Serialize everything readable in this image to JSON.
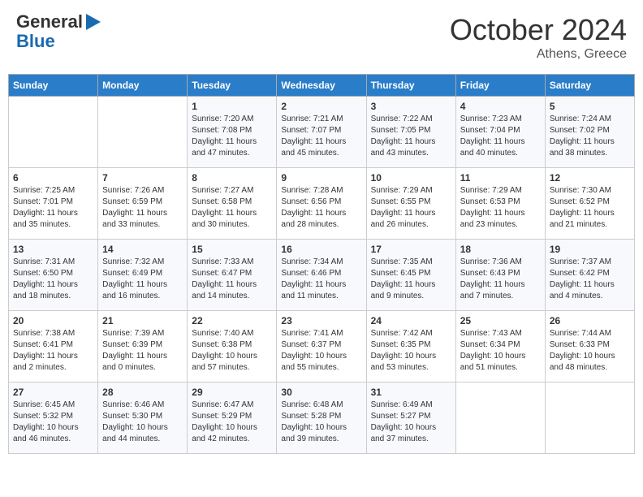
{
  "logo": {
    "general": "General",
    "blue": "Blue"
  },
  "title": {
    "month": "October 2024",
    "location": "Athens, Greece"
  },
  "days_of_week": [
    "Sunday",
    "Monday",
    "Tuesday",
    "Wednesday",
    "Thursday",
    "Friday",
    "Saturday"
  ],
  "weeks": [
    [
      {
        "day": "",
        "info": ""
      },
      {
        "day": "",
        "info": ""
      },
      {
        "day": "1",
        "info": "Sunrise: 7:20 AM\nSunset: 7:08 PM\nDaylight: 11 hours and 47 minutes."
      },
      {
        "day": "2",
        "info": "Sunrise: 7:21 AM\nSunset: 7:07 PM\nDaylight: 11 hours and 45 minutes."
      },
      {
        "day": "3",
        "info": "Sunrise: 7:22 AM\nSunset: 7:05 PM\nDaylight: 11 hours and 43 minutes."
      },
      {
        "day": "4",
        "info": "Sunrise: 7:23 AM\nSunset: 7:04 PM\nDaylight: 11 hours and 40 minutes."
      },
      {
        "day": "5",
        "info": "Sunrise: 7:24 AM\nSunset: 7:02 PM\nDaylight: 11 hours and 38 minutes."
      }
    ],
    [
      {
        "day": "6",
        "info": "Sunrise: 7:25 AM\nSunset: 7:01 PM\nDaylight: 11 hours and 35 minutes."
      },
      {
        "day": "7",
        "info": "Sunrise: 7:26 AM\nSunset: 6:59 PM\nDaylight: 11 hours and 33 minutes."
      },
      {
        "day": "8",
        "info": "Sunrise: 7:27 AM\nSunset: 6:58 PM\nDaylight: 11 hours and 30 minutes."
      },
      {
        "day": "9",
        "info": "Sunrise: 7:28 AM\nSunset: 6:56 PM\nDaylight: 11 hours and 28 minutes."
      },
      {
        "day": "10",
        "info": "Sunrise: 7:29 AM\nSunset: 6:55 PM\nDaylight: 11 hours and 26 minutes."
      },
      {
        "day": "11",
        "info": "Sunrise: 7:29 AM\nSunset: 6:53 PM\nDaylight: 11 hours and 23 minutes."
      },
      {
        "day": "12",
        "info": "Sunrise: 7:30 AM\nSunset: 6:52 PM\nDaylight: 11 hours and 21 minutes."
      }
    ],
    [
      {
        "day": "13",
        "info": "Sunrise: 7:31 AM\nSunset: 6:50 PM\nDaylight: 11 hours and 18 minutes."
      },
      {
        "day": "14",
        "info": "Sunrise: 7:32 AM\nSunset: 6:49 PM\nDaylight: 11 hours and 16 minutes."
      },
      {
        "day": "15",
        "info": "Sunrise: 7:33 AM\nSunset: 6:47 PM\nDaylight: 11 hours and 14 minutes."
      },
      {
        "day": "16",
        "info": "Sunrise: 7:34 AM\nSunset: 6:46 PM\nDaylight: 11 hours and 11 minutes."
      },
      {
        "day": "17",
        "info": "Sunrise: 7:35 AM\nSunset: 6:45 PM\nDaylight: 11 hours and 9 minutes."
      },
      {
        "day": "18",
        "info": "Sunrise: 7:36 AM\nSunset: 6:43 PM\nDaylight: 11 hours and 7 minutes."
      },
      {
        "day": "19",
        "info": "Sunrise: 7:37 AM\nSunset: 6:42 PM\nDaylight: 11 hours and 4 minutes."
      }
    ],
    [
      {
        "day": "20",
        "info": "Sunrise: 7:38 AM\nSunset: 6:41 PM\nDaylight: 11 hours and 2 minutes."
      },
      {
        "day": "21",
        "info": "Sunrise: 7:39 AM\nSunset: 6:39 PM\nDaylight: 11 hours and 0 minutes."
      },
      {
        "day": "22",
        "info": "Sunrise: 7:40 AM\nSunset: 6:38 PM\nDaylight: 10 hours and 57 minutes."
      },
      {
        "day": "23",
        "info": "Sunrise: 7:41 AM\nSunset: 6:37 PM\nDaylight: 10 hours and 55 minutes."
      },
      {
        "day": "24",
        "info": "Sunrise: 7:42 AM\nSunset: 6:35 PM\nDaylight: 10 hours and 53 minutes."
      },
      {
        "day": "25",
        "info": "Sunrise: 7:43 AM\nSunset: 6:34 PM\nDaylight: 10 hours and 51 minutes."
      },
      {
        "day": "26",
        "info": "Sunrise: 7:44 AM\nSunset: 6:33 PM\nDaylight: 10 hours and 48 minutes."
      }
    ],
    [
      {
        "day": "27",
        "info": "Sunrise: 6:45 AM\nSunset: 5:32 PM\nDaylight: 10 hours and 46 minutes."
      },
      {
        "day": "28",
        "info": "Sunrise: 6:46 AM\nSunset: 5:30 PM\nDaylight: 10 hours and 44 minutes."
      },
      {
        "day": "29",
        "info": "Sunrise: 6:47 AM\nSunset: 5:29 PM\nDaylight: 10 hours and 42 minutes."
      },
      {
        "day": "30",
        "info": "Sunrise: 6:48 AM\nSunset: 5:28 PM\nDaylight: 10 hours and 39 minutes."
      },
      {
        "day": "31",
        "info": "Sunrise: 6:49 AM\nSunset: 5:27 PM\nDaylight: 10 hours and 37 minutes."
      },
      {
        "day": "",
        "info": ""
      },
      {
        "day": "",
        "info": ""
      }
    ]
  ]
}
